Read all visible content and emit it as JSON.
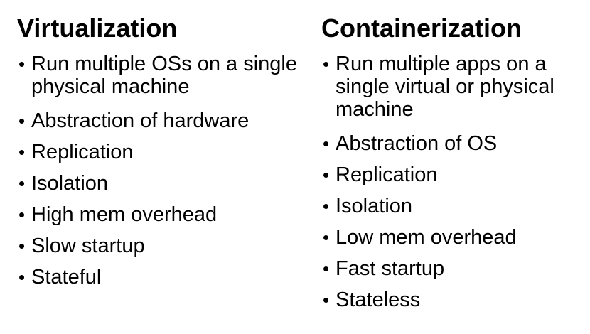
{
  "left": {
    "title": "Virtualization",
    "items": [
      "Run multiple OSs on a single physical machine",
      "Abstraction of hardware",
      "Replication",
      "Isolation",
      "High mem overhead",
      "Slow startup",
      "Stateful"
    ]
  },
  "right": {
    "title": "Containerization",
    "items": [
      "Run multiple apps on a single virtual or physical machine",
      "Abstraction of OS",
      "Replication",
      "Isolation",
      "Low mem overhead",
      "Fast startup",
      "Stateless"
    ]
  },
  "bullet_glyph": "•"
}
